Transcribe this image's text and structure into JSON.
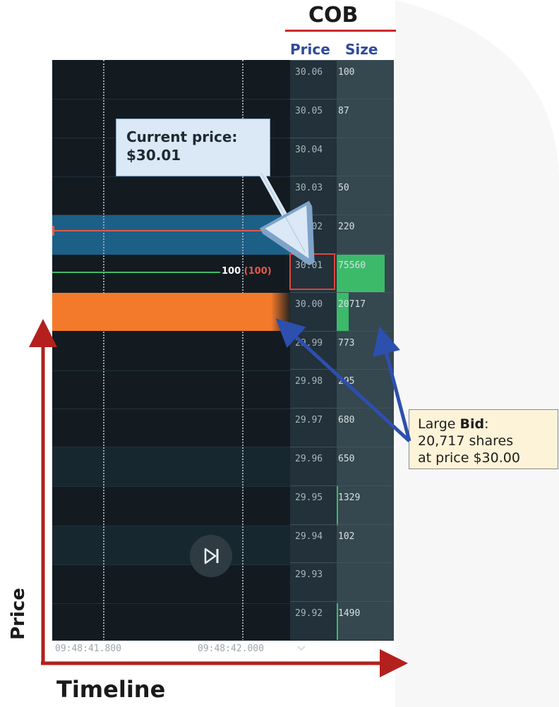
{
  "header": {
    "title": "COB",
    "price_label": "Price",
    "size_label": "Size"
  },
  "cob_rows": [
    {
      "price": "30.06",
      "size": "100"
    },
    {
      "price": "30.05",
      "size": "87"
    },
    {
      "price": "30.04",
      "size": ""
    },
    {
      "price": "30.03",
      "size": "50"
    },
    {
      "price": "30.02",
      "size": "220"
    },
    {
      "price": "30.01",
      "size": "75560"
    },
    {
      "price": "30.00",
      "size": "20717"
    },
    {
      "price": "29.99",
      "size": "773"
    },
    {
      "price": "29.98",
      "size": "295"
    },
    {
      "price": "29.97",
      "size": "680"
    },
    {
      "price": "29.96",
      "size": "650"
    },
    {
      "price": "29.95",
      "size": "1329"
    },
    {
      "price": "29.94",
      "size": "102"
    },
    {
      "price": "29.93",
      "size": ""
    },
    {
      "price": "29.92",
      "size": "1490"
    }
  ],
  "chart": {
    "order_qty": "100",
    "order_qty_paren": "(100)",
    "time_labels": [
      "09:48:41.800",
      "09:48:42.000"
    ],
    "play_icon": "skip-forward-icon"
  },
  "callouts": {
    "current_price_line1": "Current price:",
    "current_price_line2": "$30.01",
    "bid_prefix": "Large ",
    "bid_bold": "Bid",
    "bid_suffix": ":",
    "bid_line2": "20,717 shares",
    "bid_line3": "at price $30.00"
  },
  "axes": {
    "y_label": "Price",
    "x_label": "Timeline"
  },
  "colors": {
    "accent_red": "#cc2a2a",
    "header_blue": "#2f4b9b",
    "bid_green": "#3cba6a",
    "orange_band": "#f47a2b",
    "blue_band": "#1c5f87",
    "axis_red": "#b3201e"
  }
}
